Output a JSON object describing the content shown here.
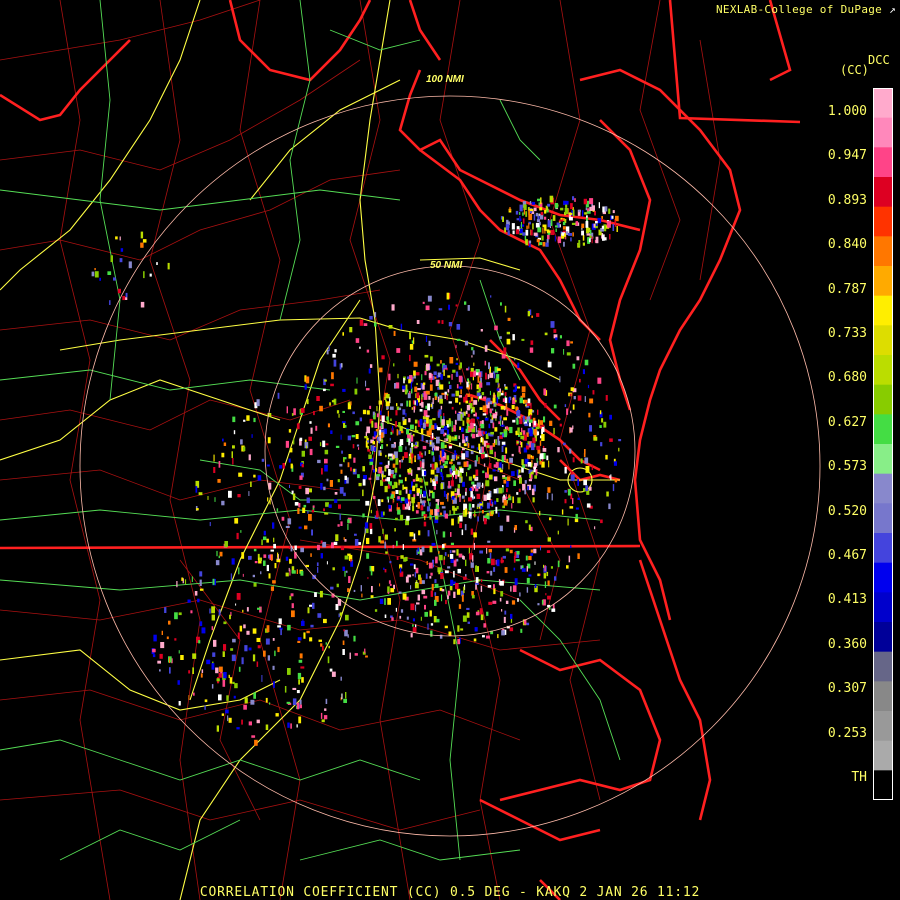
{
  "credit": {
    "text": "NEXLAB-College of DuPage",
    "external_icon": "external-link-icon"
  },
  "legend": {
    "title": "(CC)",
    "product": "DCC",
    "ticks": [
      "1.000",
      "0.947",
      "0.893",
      "0.840",
      "0.787",
      "0.733",
      "0.680",
      "0.627",
      "0.573",
      "0.520",
      "0.467",
      "0.413",
      "0.360",
      "0.307",
      "0.253",
      "TH"
    ],
    "colors": [
      "#ffaacc",
      "#ff88bb",
      "#ff4488",
      "#dd0022",
      "#ff3300",
      "#ff7700",
      "#ffaa00",
      "#ffee00",
      "#dddd00",
      "#bbdd00",
      "#88cc00",
      "#44dd44",
      "#88ee88",
      "#8888cc",
      "#7777cc",
      "#4444dd",
      "#0000ee",
      "#0000cc",
      "#000099",
      "#666688",
      "#888888",
      "#999999",
      "#aaaaaa",
      "#000000"
    ]
  },
  "range_rings": [
    {
      "label": "100 NMI"
    },
    {
      "label": "50 NMI"
    }
  ],
  "footer": {
    "text": "CORRELATION COEFFICIENT (CC) 0.5 DEG - KAKQ 2 JAN 26 11:12"
  },
  "map_colors": {
    "state_border": "#ff2020",
    "county_border": "#aa1111",
    "highway": "#ffff44",
    "road": "#55dd55",
    "range_ring": "#ffbbaa"
  }
}
